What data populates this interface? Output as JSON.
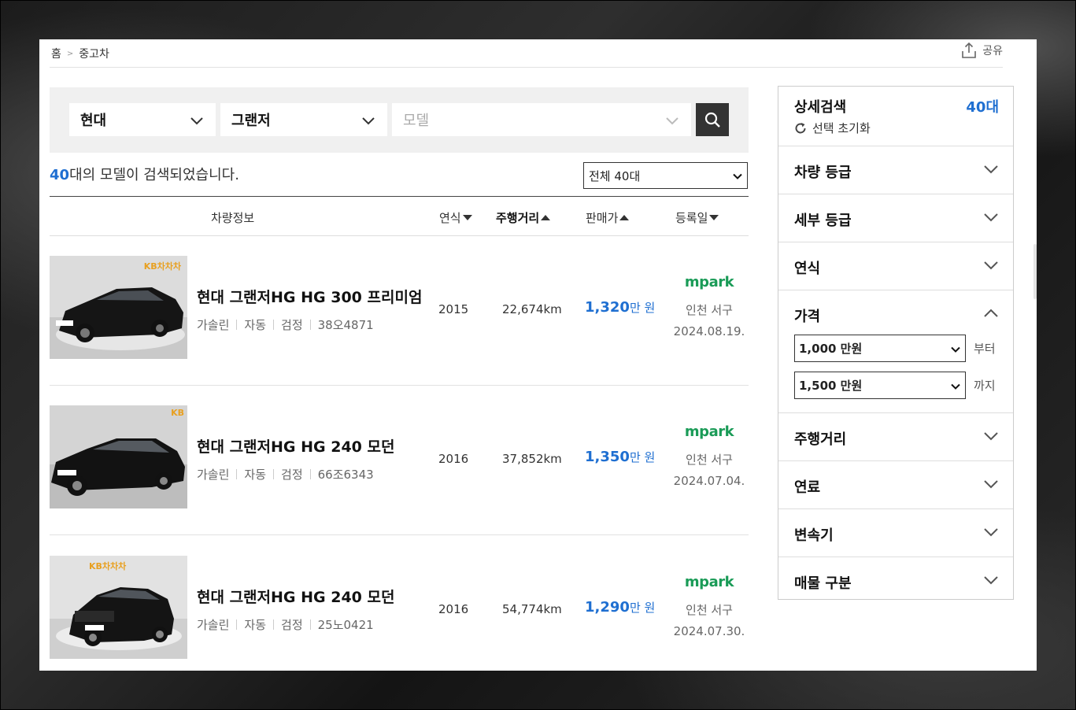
{
  "breadcrumb": {
    "home": "홈",
    "separator": ">",
    "current": "중고차"
  },
  "share": {
    "label": "공유",
    "icon": "share-icon"
  },
  "search": {
    "maker": "현대",
    "model_group": "그랜저",
    "model_placeholder": "모델",
    "button_icon": "search-icon"
  },
  "result": {
    "count": "40",
    "suffix": "대의 모델이 검색되었습니다."
  },
  "sort_select": {
    "value": "전체 40대"
  },
  "table_header": {
    "info": "차량정보",
    "year": "연식",
    "mileage": "주행거리",
    "price": "판매가",
    "date": "등록일"
  },
  "listings": [
    {
      "name": "현대 그랜저HG HG 300 프리미엄",
      "fuel": "가솔린",
      "transmission": "자동",
      "color": "검정",
      "plate": "38오4871",
      "year": "2015",
      "mileage": "22,674km",
      "price": "1,320",
      "price_unit": "만 원",
      "dealer": "mpark",
      "location": "인천 서구",
      "date": "2024.08.19.",
      "watermark": "KB차차차"
    },
    {
      "name": "현대 그랜저HG HG 240 모던",
      "fuel": "가솔린",
      "transmission": "자동",
      "color": "검정",
      "plate": "66조6343",
      "year": "2016",
      "mileage": "37,852km",
      "price": "1,350",
      "price_unit": "만 원",
      "dealer": "mpark",
      "location": "인천 서구",
      "date": "2024.07.04.",
      "watermark": "KB"
    },
    {
      "name": "현대 그랜저HG HG 240 모던",
      "fuel": "가솔린",
      "transmission": "자동",
      "color": "검정",
      "plate": "25노0421",
      "year": "2016",
      "mileage": "54,774km",
      "price": "1,290",
      "price_unit": "만 원",
      "dealer": "mpark",
      "location": "인천 서구",
      "date": "2024.07.30.",
      "watermark": "KB차차차"
    }
  ],
  "sidebar": {
    "title": "상세검색",
    "count": "40대",
    "reset_label": "선택 초기화",
    "facets": {
      "grade": "차량 등급",
      "sub_grade": "세부 등급",
      "year": "연식",
      "price": "가격",
      "mileage": "주행거리",
      "fuel": "연료",
      "transmission": "변속기",
      "listing_type": "매물 구분"
    },
    "price_from": {
      "value": "1,000 만원",
      "suffix": "부터"
    },
    "price_to": {
      "value": "1,500 만원",
      "suffix": "까지"
    }
  },
  "colors": {
    "accent": "#1f6fd1",
    "dealer_green": "#1a9b57",
    "search_button": "#333333"
  }
}
